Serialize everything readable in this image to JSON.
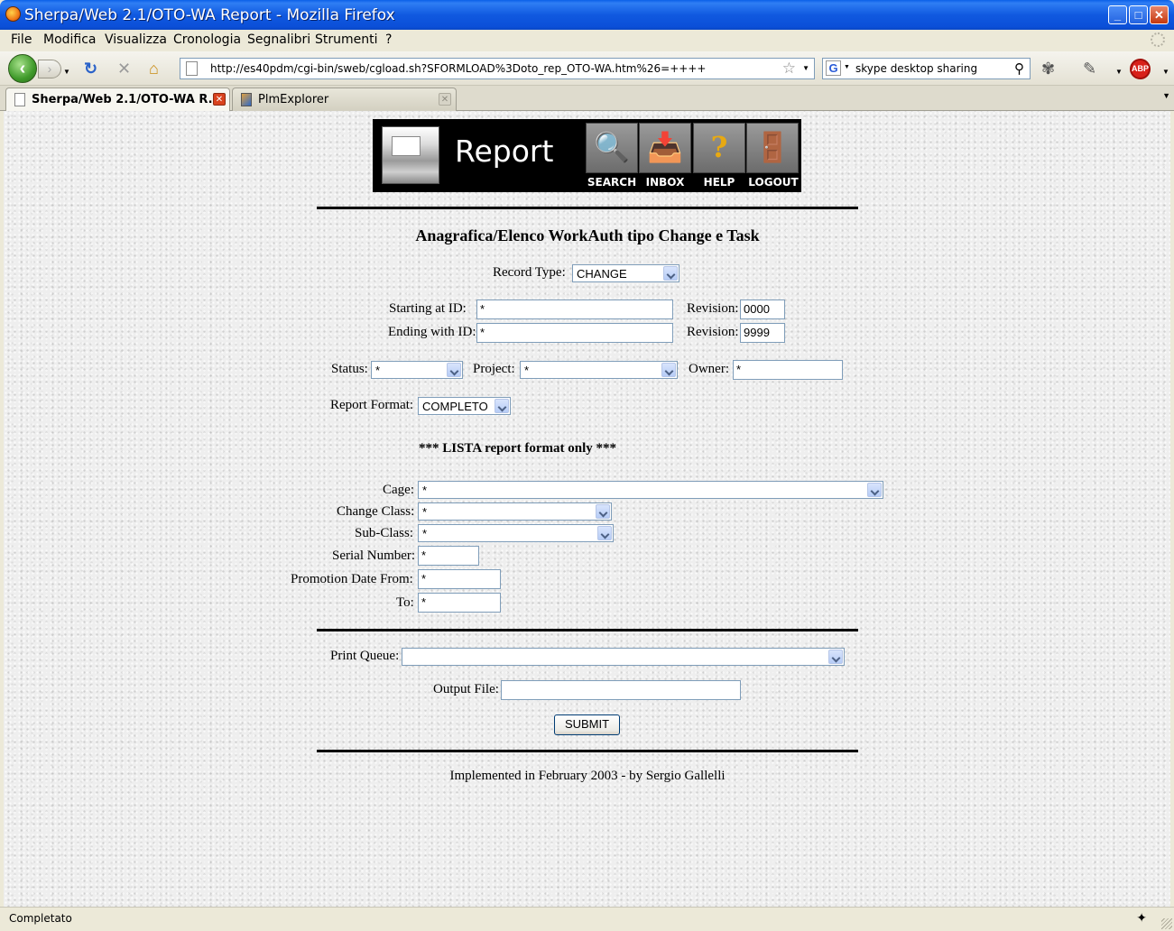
{
  "window": {
    "title": "Sherpa/Web 2.1/OTO-WA Report - Mozilla Firefox"
  },
  "menu": [
    "File",
    "Modifica",
    "Visualizza",
    "Cronologia",
    "Segnalibri",
    "Strumenti",
    "?"
  ],
  "nav": {
    "url": "http://es40pdm/cgi-bin/sweb/cgload.sh?SFORMLOAD%3Doto_rep_OTO-WA.htm%26=++++",
    "search_text": "skype desktop sharing",
    "search_engine_letter": "G",
    "abp_label": "ABP"
  },
  "tabs": [
    {
      "label": "Sherpa/Web 2.1/OTO-WA R...",
      "active": true
    },
    {
      "label": "PlmExplorer",
      "active": false
    }
  ],
  "banner": {
    "title": "Report",
    "buttons": [
      "SEARCH",
      "INBOX",
      "HELP",
      "LOGOUT"
    ]
  },
  "form": {
    "heading": "Anagrafica/Elenco WorkAuth tipo Change e Task",
    "record_type": {
      "label": "Record Type:",
      "value": "CHANGE"
    },
    "starting_id": {
      "label": "Starting at ID:",
      "value": "*"
    },
    "starting_rev": {
      "label": "Revision:",
      "value": "0000"
    },
    "ending_id": {
      "label": "Ending with ID:",
      "value": "*"
    },
    "ending_rev": {
      "label": "Revision:",
      "value": "9999"
    },
    "status": {
      "label": "Status:",
      "value": "*"
    },
    "project": {
      "label": "Project:",
      "value": "*"
    },
    "owner": {
      "label": "Owner:",
      "value": "*"
    },
    "report_format": {
      "label": "Report Format:",
      "value": "COMPLETO"
    },
    "lista_note": "*** LISTA report format only ***",
    "cage": {
      "label": "Cage:",
      "value": "*"
    },
    "change_class": {
      "label": "Change Class:",
      "value": "*"
    },
    "sub_class": {
      "label": "Sub-Class:",
      "value": "*"
    },
    "serial_number": {
      "label": "Serial Number:",
      "value": "*"
    },
    "promo_from": {
      "label": "Promotion Date From:",
      "value": "*"
    },
    "promo_to": {
      "label": "To:",
      "value": "*"
    },
    "print_queue": {
      "label": "Print Queue:",
      "value": ""
    },
    "output_file": {
      "label": "Output File:",
      "value": ""
    },
    "submit_label": "SUBMIT"
  },
  "footer": "Implemented in February 2003 - by Sergio Gallelli",
  "status_bar": "Completato"
}
